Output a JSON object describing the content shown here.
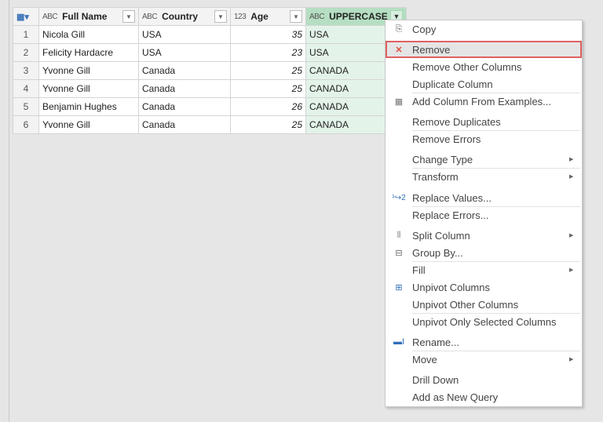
{
  "table": {
    "columns": [
      {
        "type_icon": "ABC",
        "label": "Full Name"
      },
      {
        "type_icon": "ABC",
        "label": "Country"
      },
      {
        "type_icon": "123",
        "label": "Age"
      },
      {
        "type_icon": "ABC",
        "label": "UPPERCASE"
      }
    ],
    "rows": [
      {
        "n": "1",
        "name": "Nicola Gill",
        "country": "USA",
        "age": "35",
        "upper": "USA"
      },
      {
        "n": "2",
        "name": "Felicity Hardacre",
        "country": "USA",
        "age": "23",
        "upper": "USA"
      },
      {
        "n": "3",
        "name": "Yvonne Gill",
        "country": "Canada",
        "age": "25",
        "upper": "CANADA"
      },
      {
        "n": "4",
        "name": "Yvonne Gill",
        "country": "Canada",
        "age": "25",
        "upper": "CANADA"
      },
      {
        "n": "5",
        "name": "Benjamin Hughes",
        "country": "Canada",
        "age": "26",
        "upper": "CANADA"
      },
      {
        "n": "6",
        "name": "Yvonne Gill",
        "country": "Canada",
        "age": "25",
        "upper": "CANADA"
      }
    ]
  },
  "menu": {
    "items": [
      {
        "label": "Copy",
        "icon": "copy-icon"
      },
      {
        "label": "Remove",
        "icon": "remove-column-icon",
        "highlighted": true
      },
      {
        "label": "Remove Other Columns"
      },
      {
        "label": "Duplicate Column"
      },
      {
        "label": "Add Column From Examples...",
        "icon": "add-column-examples-icon"
      },
      {
        "label": "Remove Duplicates"
      },
      {
        "label": "Remove Errors"
      },
      {
        "label": "Change Type",
        "submenu": true
      },
      {
        "label": "Transform",
        "submenu": true
      },
      {
        "label": "Replace Values...",
        "icon": "replace-values-icon"
      },
      {
        "label": "Replace Errors..."
      },
      {
        "label": "Split Column",
        "icon": "split-column-icon",
        "submenu": true
      },
      {
        "label": "Group By...",
        "icon": "group-by-icon"
      },
      {
        "label": "Fill",
        "submenu": true
      },
      {
        "label": "Unpivot Columns",
        "icon": "unpivot-icon"
      },
      {
        "label": "Unpivot Other Columns"
      },
      {
        "label": "Unpivot Only Selected Columns"
      },
      {
        "label": "Rename...",
        "icon": "rename-icon"
      },
      {
        "label": "Move",
        "submenu": true
      },
      {
        "label": "Drill Down"
      },
      {
        "label": "Add as New Query"
      }
    ]
  }
}
